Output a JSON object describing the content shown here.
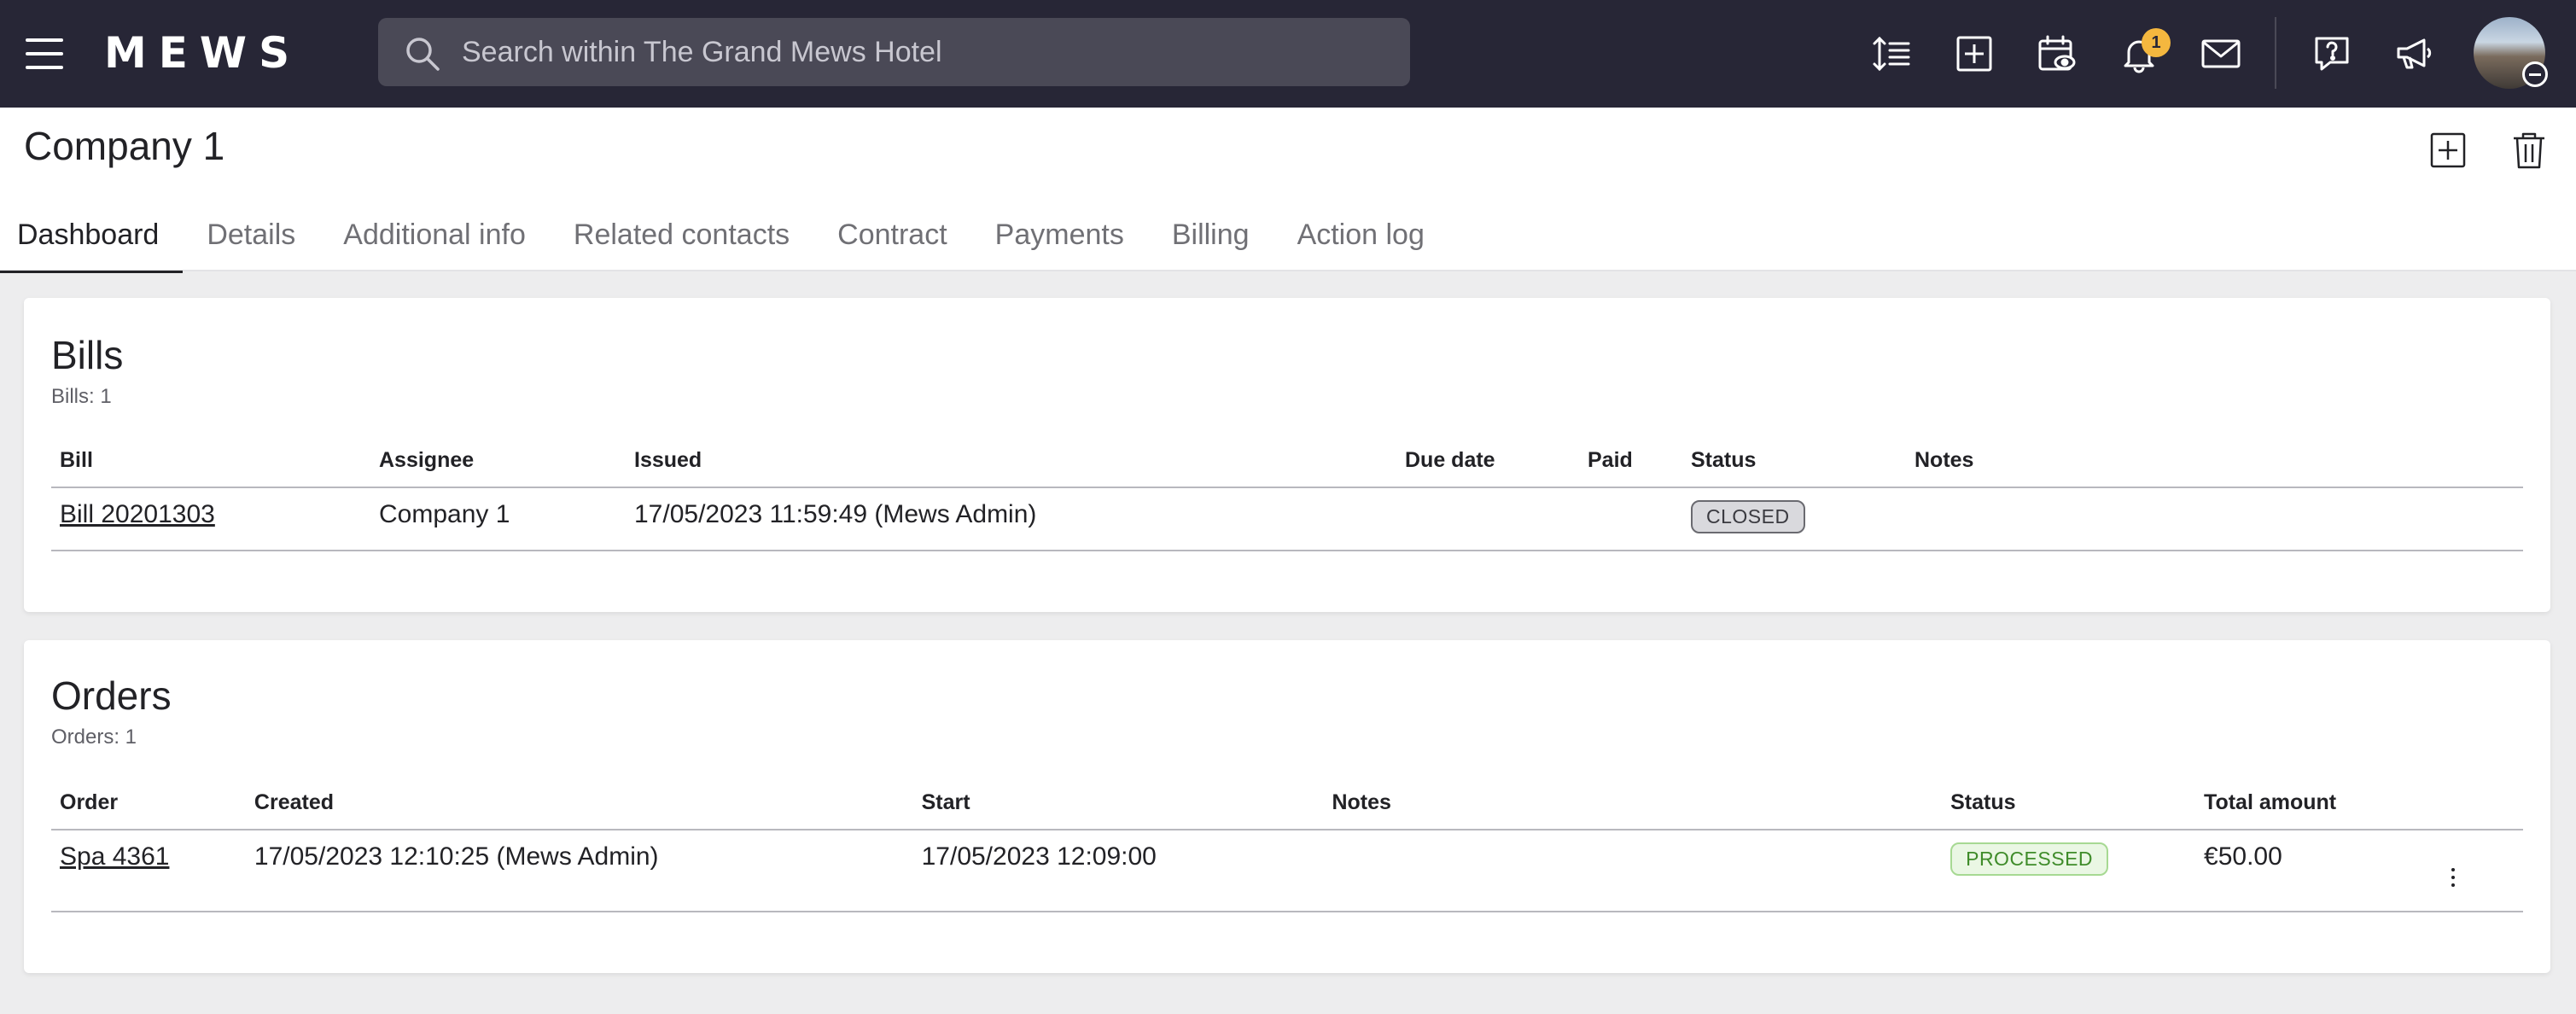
{
  "app": {
    "logo_text": "MEWS",
    "search_placeholder": "Search within The Grand Mews Hotel",
    "notification_count": "1",
    "icons": [
      "menu-icon",
      "sort-lines-icon",
      "add-square-icon",
      "calendar-view-icon",
      "bell-icon",
      "mail-icon",
      "help-icon",
      "megaphone-icon",
      "avatar"
    ]
  },
  "page": {
    "title": "Company 1",
    "tabs": [
      {
        "label": "Dashboard",
        "active": true
      },
      {
        "label": "Details",
        "active": false
      },
      {
        "label": "Additional info",
        "active": false
      },
      {
        "label": "Related contacts",
        "active": false
      },
      {
        "label": "Contract",
        "active": false
      },
      {
        "label": "Payments",
        "active": false
      },
      {
        "label": "Billing",
        "active": false
      },
      {
        "label": "Action log",
        "active": false
      }
    ]
  },
  "bills": {
    "title": "Bills",
    "count_text": "Bills: 1",
    "columns": [
      "Bill",
      "Assignee",
      "Issued",
      "Due date",
      "Paid",
      "Status",
      "Notes"
    ],
    "rows": [
      {
        "bill": "Bill 20201303",
        "assignee": "Company 1",
        "issued": "17/05/2023 11:59:49 (Mews Admin)",
        "due_date": "",
        "paid": "",
        "status": "CLOSED",
        "notes": ""
      }
    ]
  },
  "orders": {
    "title": "Orders",
    "count_text": "Orders: 1",
    "columns": [
      "Order",
      "Created",
      "Start",
      "Notes",
      "Status",
      "Total amount"
    ],
    "rows": [
      {
        "order": "Spa 4361",
        "created": "17/05/2023 12:10:25 (Mews Admin)",
        "start": "17/05/2023 12:09:00",
        "notes": "",
        "status": "PROCESSED",
        "total": "€50.00"
      }
    ]
  },
  "colors": {
    "topbar": "#272636",
    "background": "#ededee",
    "badge": "#f4b73f",
    "processed": "#3f8c2a"
  }
}
